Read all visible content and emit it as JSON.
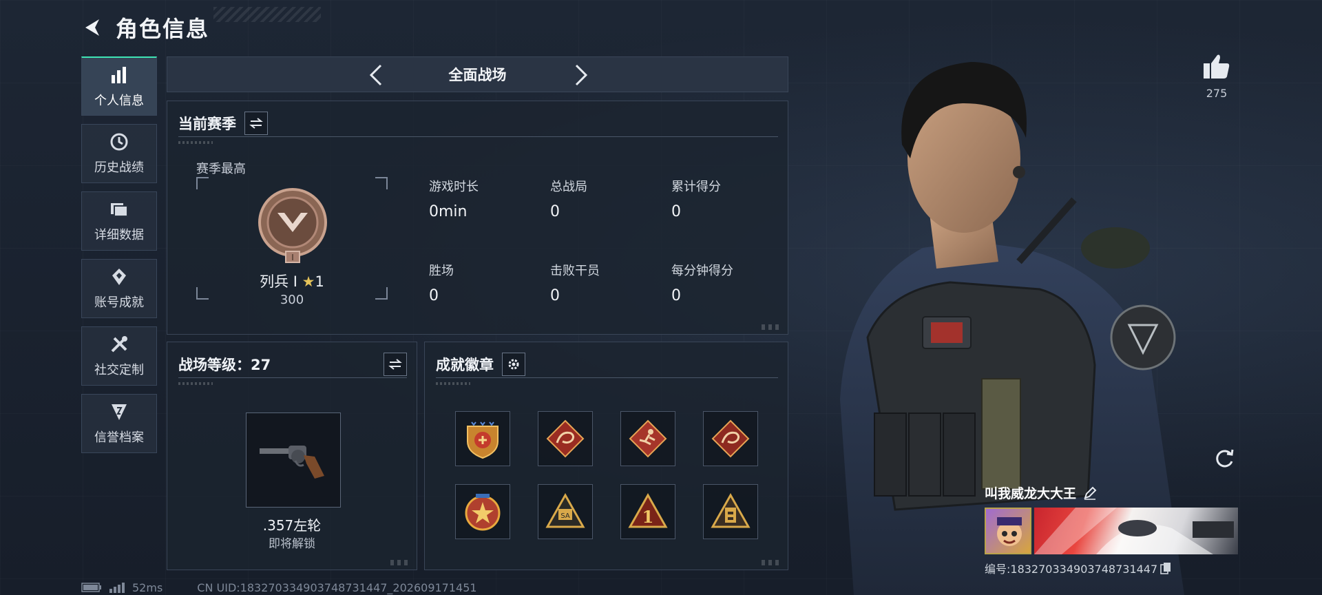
{
  "header": {
    "title": "角色信息"
  },
  "sidebar": {
    "items": [
      {
        "label": "个人信息",
        "icon": "bar-chart-icon",
        "active": true
      },
      {
        "label": "历史战绩",
        "icon": "history-clock-icon"
      },
      {
        "label": "详细数据",
        "icon": "folder-icon"
      },
      {
        "label": "账号成就",
        "icon": "achievement-icon"
      },
      {
        "label": "社交定制",
        "icon": "tools-icon"
      },
      {
        "label": "信誉档案",
        "icon": "credit-shield-icon"
      }
    ]
  },
  "mode": {
    "title": "全面战场"
  },
  "season": {
    "title": "当前赛季",
    "peak_label": "赛季最高",
    "rank_name": "列兵 Ⅰ",
    "rank_stars": "1",
    "rank_score": "300",
    "stats": [
      {
        "label": "游戏时长",
        "value": "0min"
      },
      {
        "label": "总战局",
        "value": "0"
      },
      {
        "label": "累计得分",
        "value": "0"
      },
      {
        "label": "胜场",
        "value": "0"
      },
      {
        "label": "击败干员",
        "value": "0"
      },
      {
        "label": "每分钟得分",
        "value": "0"
      }
    ]
  },
  "level": {
    "title": "战场等级：27",
    "weapon_name": ".357左轮",
    "weapon_status": "即将解锁"
  },
  "badges": {
    "title": "成就徽章",
    "items": [
      "shield-star-badge",
      "dragon-badge",
      "runner-badge",
      "dragon-badge-2",
      "star-medal-badge",
      "sa-triangle-badge",
      "number-one-badge",
      "tower-badge"
    ]
  },
  "profile": {
    "likes": "275",
    "player_name": "叫我威龙大大王",
    "player_id": "编号:1832703349037487314​47"
  },
  "footer": {
    "ping": "52ms",
    "uid": "CN UID:183270334903748731447_202609171451"
  },
  "colors": {
    "accent": "#3fe6b5",
    "gold": "#e6c45a",
    "panel": "#1c2430"
  }
}
